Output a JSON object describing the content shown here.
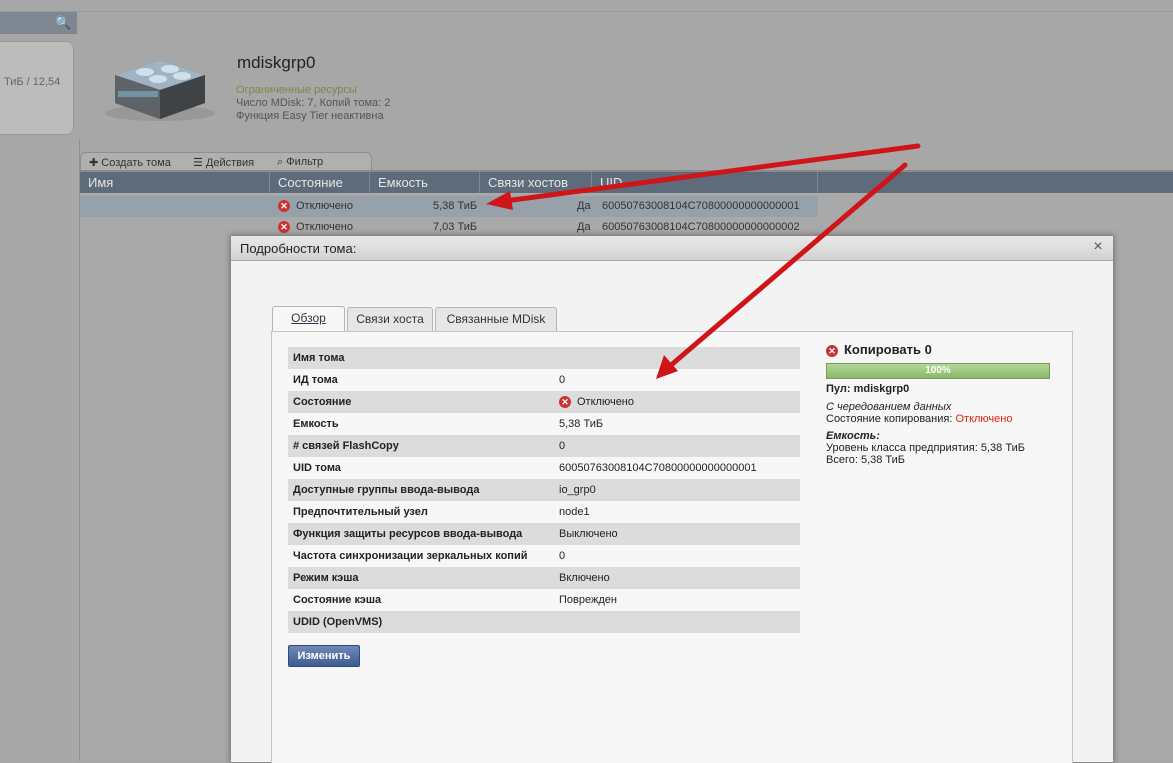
{
  "sidebar": {
    "capacity_text": "ТиБ / 12,54"
  },
  "pool": {
    "name": "mdiskgrp0",
    "status": "Ограниченные ресурсы",
    "line2": "Число MDisk: 7, Копий тома: 2",
    "line3": "Функция Easy Tier неактивна"
  },
  "toolbar": {
    "create": "Создать тома",
    "actions": "Действия",
    "filter": "Фильтр"
  },
  "table": {
    "headers": [
      "Имя",
      "Состояние",
      "Емкость",
      "Связи хостов",
      "UID"
    ],
    "rows": [
      {
        "name": "",
        "status": "Отключено",
        "capacity": "5,38 ТиБ",
        "host_links": "Да",
        "uid": "60050763008104C70800000000000001"
      },
      {
        "name": "",
        "status": "Отключено",
        "capacity": "7,03 ТиБ",
        "host_links": "Да",
        "uid": "60050763008104C70800000000000002"
      }
    ]
  },
  "dialog": {
    "title": "Подробности тома:",
    "close": "×",
    "tabs": [
      "Обзор",
      "Связи хоста",
      "Связанные MDisk"
    ],
    "properties": [
      {
        "label": "Имя тома",
        "value": ""
      },
      {
        "label": "ИД тома",
        "value": "0"
      },
      {
        "label": "Состояние",
        "value": "Отключено"
      },
      {
        "label": "Емкость",
        "value": "5,38 ТиБ"
      },
      {
        "label": "# связей FlashCopy",
        "value": "0"
      },
      {
        "label": "UID тома",
        "value": "60050763008104C70800000000000001"
      },
      {
        "label": "Доступные группы ввода-вывода",
        "value": "io_grp0"
      },
      {
        "label": "Предпочтительный узел",
        "value": "node1"
      },
      {
        "label": "Функция защиты ресурсов ввода-вывода",
        "value": "Выключено"
      },
      {
        "label": "Частота синхронизации зеркальных копий",
        "value": "0"
      },
      {
        "label": "Режим кэша",
        "value": "Включено"
      },
      {
        "label": "Состояние кэша",
        "value": "Поврежден"
      },
      {
        "label": "UDID (OpenVMS)",
        "value": ""
      }
    ],
    "edit_button": "Изменить",
    "copy": {
      "title": "Копировать 0",
      "progress_label": "100%",
      "progress_fraction": 1.0,
      "pool_label": "Пул: mdiskgrp0",
      "striping": "С чередованием данных",
      "copy_state_label": "Состояние копирования: ",
      "copy_state_value": "Отключено",
      "capacity_heading": "Емкость:",
      "tier_line": "Уровень класса предприятия: 5,38 ТиБ",
      "total_line": "Всего: 5,38 ТиБ"
    }
  },
  "colors": {
    "arrow": "#d0151a",
    "error": "#cc3333"
  }
}
